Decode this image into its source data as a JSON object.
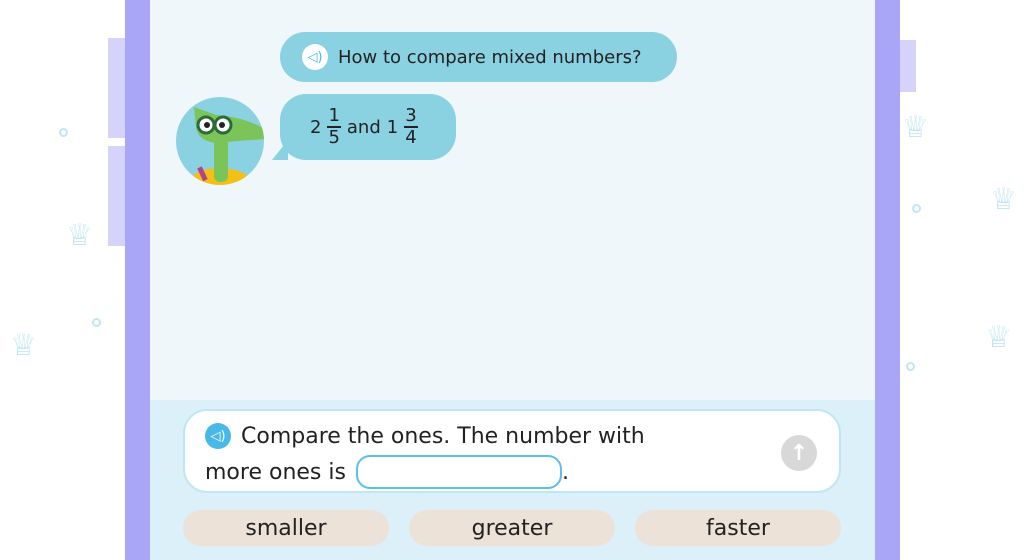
{
  "chat": {
    "question": "How to compare mixed numbers?",
    "numbers": {
      "first": {
        "whole": "2",
        "numerator": "1",
        "denominator": "5"
      },
      "connector": "and",
      "second": {
        "whole": "1",
        "numerator": "3",
        "denominator": "4"
      }
    }
  },
  "prompt": {
    "line1": "Compare the ones. The number with",
    "line2": "more ones is",
    "line2_end": ".",
    "answer": ""
  },
  "options": [
    "smaller",
    "greater",
    "faster"
  ],
  "icons": {
    "speaker": "speaker-icon",
    "submit": "arrow-up-icon",
    "avatar": "crocodile-mascot"
  }
}
